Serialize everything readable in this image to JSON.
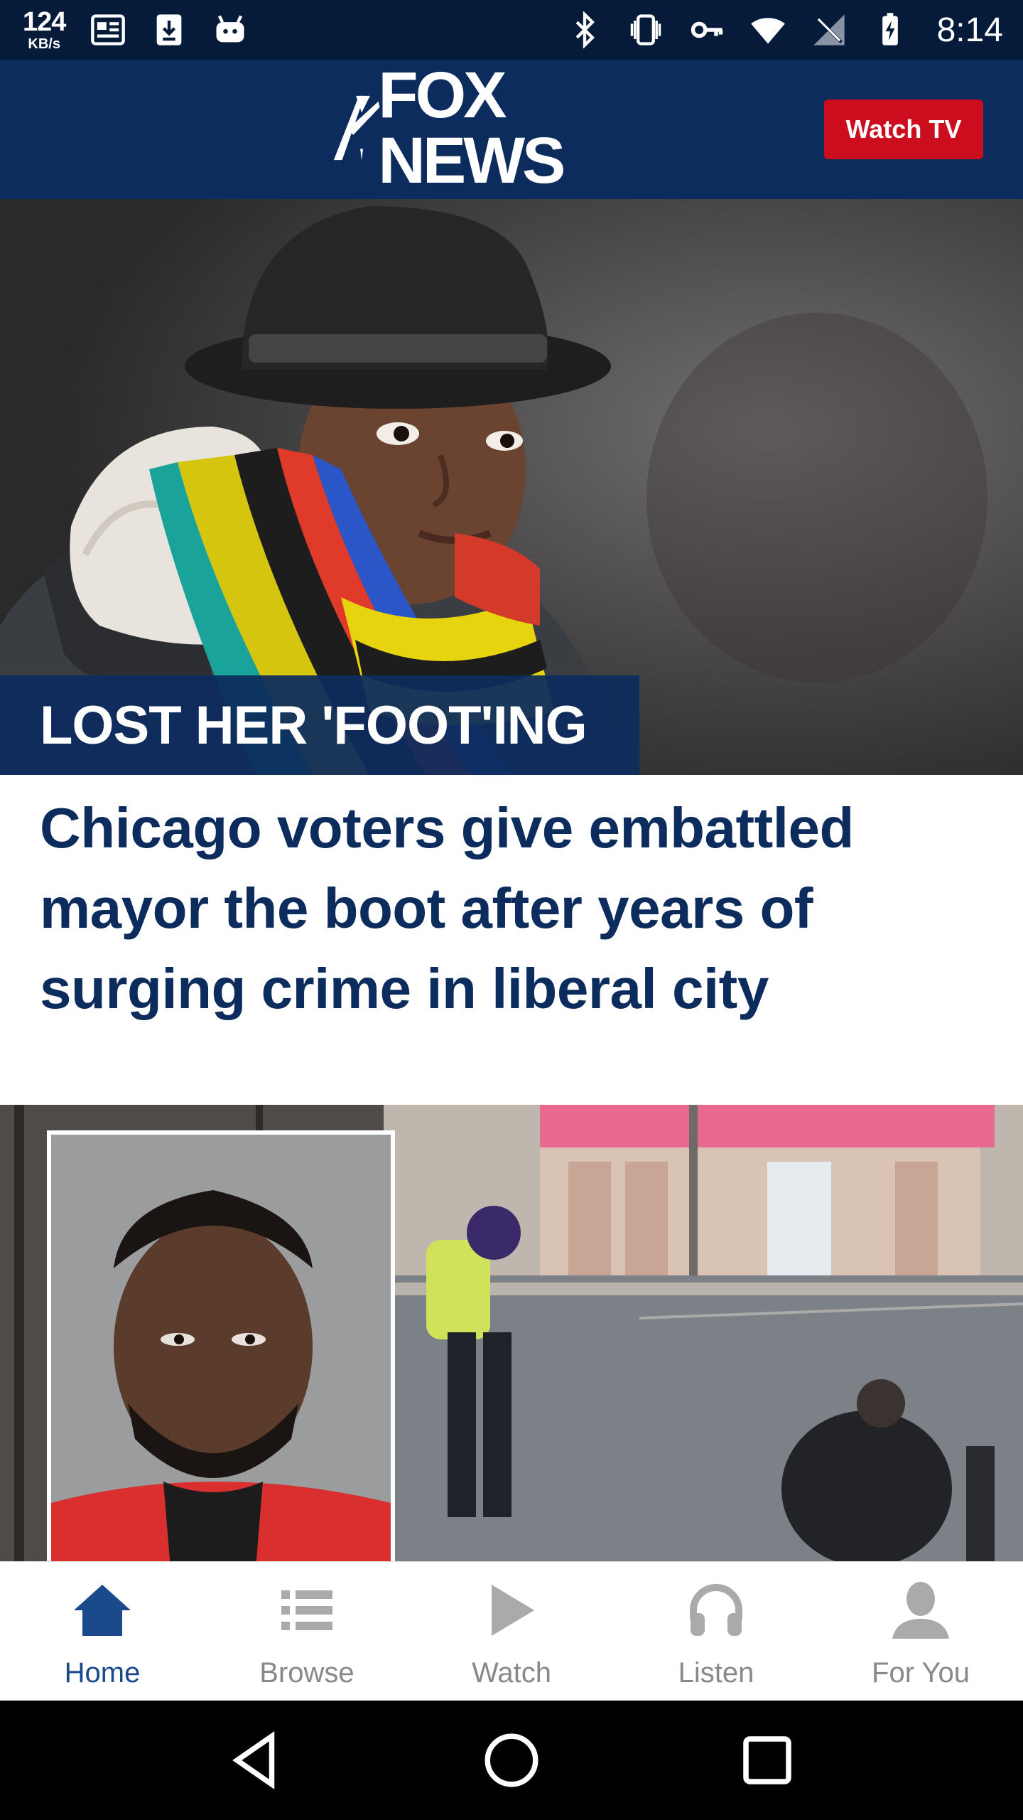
{
  "status_bar": {
    "net_speed": "124",
    "net_unit": "KB/s",
    "time": "8:14",
    "left_icons": [
      "news-icon",
      "download-icon",
      "android-icon"
    ],
    "right_icons": [
      "bluetooth-icon",
      "vibrate-icon",
      "vpn-key-icon",
      "wifi-icon",
      "no-signal-icon",
      "battery-charging-icon"
    ]
  },
  "header": {
    "logo_text": "FOX NEWS",
    "watch_tv_label": "Watch TV",
    "background_color": "#0d2c5e",
    "button_color": "#cc0d1e"
  },
  "hero": {
    "kicker": "LOST HER 'FOOT'ING",
    "headline": "Chicago voters give embattled mayor the boot after years of surging crime in liberal city",
    "image": "woman-in-black-hat-and-striped-scarf"
  },
  "second_story": {
    "image": "mugshot-and-street-surveillance-photo"
  },
  "bottom_nav": {
    "items": [
      {
        "label": "Home",
        "icon": "home-icon",
        "active": true
      },
      {
        "label": "Browse",
        "icon": "list-icon",
        "active": false
      },
      {
        "label": "Watch",
        "icon": "play-icon",
        "active": false
      },
      {
        "label": "Listen",
        "icon": "headphones-icon",
        "active": false
      },
      {
        "label": "For You",
        "icon": "person-icon",
        "active": false
      }
    ],
    "active_color": "#1a4a8c",
    "inactive_color": "#888888"
  },
  "system_nav": {
    "buttons": [
      "back-icon",
      "home-circle-icon",
      "recents-icon"
    ]
  }
}
